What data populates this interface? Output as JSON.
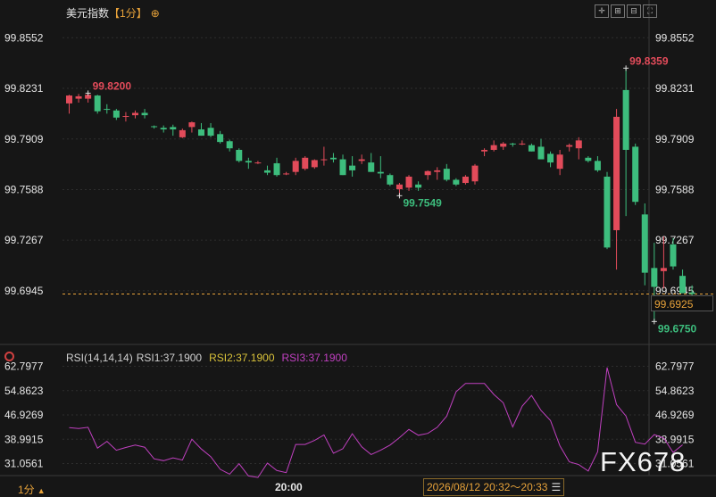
{
  "header": {
    "title": "美元指数",
    "timeframe": "【1分】",
    "marker": "⊕"
  },
  "toolbar_icons": [
    "crosshair-icon",
    "zoom-in-icon",
    "zoom-out-icon",
    "fullscreen-icon"
  ],
  "colors": {
    "up": "#e24b5a",
    "down": "#3dbd7d",
    "last_price_line": "#e8a33a",
    "rsi": "#c040c0",
    "grid": "#2e2e2e",
    "axis_text": "#e6e6e6"
  },
  "chart_data": [
    {
      "type": "candlestick",
      "title": "美元指数",
      "y_ticks": [
        "99.8552",
        "99.8231",
        "99.7909",
        "99.7588",
        "99.7267",
        "99.6945"
      ],
      "ylim": [
        99.665,
        99.865
      ],
      "annotations": {
        "high_left": "99.8200",
        "high_right": "99.8359",
        "low_mid": "99.7549",
        "low_right": "99.6750"
      },
      "last_price": "99.6925",
      "last_price_value": 99.6925,
      "candles": [
        {
          "o": 99.8135,
          "h": 99.819,
          "l": 99.807,
          "c": 99.8185
        },
        {
          "o": 99.8165,
          "h": 99.8195,
          "l": 99.814,
          "c": 99.818
        },
        {
          "o": 99.8165,
          "h": 99.82,
          "l": 99.814,
          "c": 99.819
        },
        {
          "o": 99.8185,
          "h": 99.819,
          "l": 99.807,
          "c": 99.8085
        },
        {
          "o": 99.81,
          "h": 99.813,
          "l": 99.807,
          "c": 99.8095
        },
        {
          "o": 99.809,
          "h": 99.81,
          "l": 99.803,
          "c": 99.8045
        },
        {
          "o": 99.805,
          "h": 99.808,
          "l": 99.802,
          "c": 99.8055
        },
        {
          "o": 99.806,
          "h": 99.809,
          "l": 99.804,
          "c": 99.8075
        },
        {
          "o": 99.8075,
          "h": 99.81,
          "l": 99.804,
          "c": 99.806
        },
        {
          "o": 99.799,
          "h": 99.7995,
          "l": 99.7975,
          "c": 99.7985
        },
        {
          "o": 99.798,
          "h": 99.7995,
          "l": 99.795,
          "c": 99.797
        },
        {
          "o": 99.7985,
          "h": 99.8,
          "l": 99.793,
          "c": 99.797
        },
        {
          "o": 99.792,
          "h": 99.7975,
          "l": 99.7915,
          "c": 99.7965
        },
        {
          "o": 99.7985,
          "h": 99.802,
          "l": 99.795,
          "c": 99.8015
        },
        {
          "o": 99.797,
          "h": 99.801,
          "l": 99.793,
          "c": 99.793
        },
        {
          "o": 99.798,
          "h": 99.801,
          "l": 99.792,
          "c": 99.793
        },
        {
          "o": 99.794,
          "h": 99.796,
          "l": 99.788,
          "c": 99.789
        },
        {
          "o": 99.7895,
          "h": 99.7905,
          "l": 99.783,
          "c": 99.785
        },
        {
          "o": 99.784,
          "h": 99.785,
          "l": 99.776,
          "c": 99.777
        },
        {
          "o": 99.777,
          "h": 99.779,
          "l": 99.772,
          "c": 99.776
        },
        {
          "o": 99.776,
          "h": 99.777,
          "l": 99.775,
          "c": 99.776
        },
        {
          "o": 99.771,
          "h": 99.774,
          "l": 99.768,
          "c": 99.7695
        },
        {
          "o": 99.7755,
          "h": 99.779,
          "l": 99.767,
          "c": 99.768
        },
        {
          "o": 99.7685,
          "h": 99.77,
          "l": 99.768,
          "c": 99.769
        },
        {
          "o": 99.77,
          "h": 99.779,
          "l": 99.768,
          "c": 99.777
        },
        {
          "o": 99.772,
          "h": 99.78,
          "l": 99.771,
          "c": 99.779
        },
        {
          "o": 99.773,
          "h": 99.778,
          "l": 99.772,
          "c": 99.7775
        },
        {
          "o": 99.778,
          "h": 99.786,
          "l": 99.774,
          "c": 99.778
        },
        {
          "o": 99.779,
          "h": 99.782,
          "l": 99.776,
          "c": 99.778
        },
        {
          "o": 99.778,
          "h": 99.781,
          "l": 99.768,
          "c": 99.768
        },
        {
          "o": 99.774,
          "h": 99.78,
          "l": 99.767,
          "c": 99.771
        },
        {
          "o": 99.777,
          "h": 99.781,
          "l": 99.775,
          "c": 99.778
        },
        {
          "o": 99.776,
          "h": 99.782,
          "l": 99.77,
          "c": 99.77
        },
        {
          "o": 99.77,
          "h": 99.78,
          "l": 99.766,
          "c": 99.769
        },
        {
          "o": 99.768,
          "h": 99.769,
          "l": 99.761,
          "c": 99.762
        },
        {
          "o": 99.759,
          "h": 99.763,
          "l": 99.7549,
          "c": 99.762
        },
        {
          "o": 99.76,
          "h": 99.768,
          "l": 99.758,
          "c": 99.767
        },
        {
          "o": 99.762,
          "h": 99.764,
          "l": 99.758,
          "c": 99.76
        },
        {
          "o": 99.768,
          "h": 99.771,
          "l": 99.765,
          "c": 99.7705
        },
        {
          "o": 99.77,
          "h": 99.773,
          "l": 99.765,
          "c": 99.771
        },
        {
          "o": 99.772,
          "h": 99.775,
          "l": 99.764,
          "c": 99.765
        },
        {
          "o": 99.765,
          "h": 99.766,
          "l": 99.761,
          "c": 99.762
        },
        {
          "o": 99.763,
          "h": 99.768,
          "l": 99.762,
          "c": 99.767
        },
        {
          "o": 99.764,
          "h": 99.775,
          "l": 99.762,
          "c": 99.774
        },
        {
          "o": 99.783,
          "h": 99.785,
          "l": 99.78,
          "c": 99.784
        },
        {
          "o": 99.784,
          "h": 99.79,
          "l": 99.783,
          "c": 99.787
        },
        {
          "o": 99.786,
          "h": 99.789,
          "l": 99.784,
          "c": 99.788
        },
        {
          "o": 99.788,
          "h": 99.7885,
          "l": 99.786,
          "c": 99.7875
        },
        {
          "o": 99.788,
          "h": 99.79,
          "l": 99.787,
          "c": 99.788
        },
        {
          "o": 99.787,
          "h": 99.788,
          "l": 99.783,
          "c": 99.783
        },
        {
          "o": 99.786,
          "h": 99.791,
          "l": 99.778,
          "c": 99.778
        },
        {
          "o": 99.7815,
          "h": 99.783,
          "l": 99.773,
          "c": 99.776
        },
        {
          "o": 99.772,
          "h": 99.784,
          "l": 99.768,
          "c": 99.781
        },
        {
          "o": 99.786,
          "h": 99.788,
          "l": 99.783,
          "c": 99.787
        },
        {
          "o": 99.785,
          "h": 99.792,
          "l": 99.778,
          "c": 99.79
        },
        {
          "o": 99.779,
          "h": 99.78,
          "l": 99.776,
          "c": 99.777
        },
        {
          "o": 99.777,
          "h": 99.78,
          "l": 99.77,
          "c": 99.771
        },
        {
          "o": 99.767,
          "h": 99.77,
          "l": 99.721,
          "c": 99.722
        },
        {
          "o": 99.733,
          "h": 99.81,
          "l": 99.708,
          "c": 99.805
        },
        {
          "o": 99.822,
          "h": 99.8359,
          "l": 99.742,
          "c": 99.784
        },
        {
          "o": 99.786,
          "h": 99.788,
          "l": 99.749,
          "c": 99.751
        },
        {
          "o": 99.743,
          "h": 99.75,
          "l": 99.698,
          "c": 99.706
        },
        {
          "o": 99.709,
          "h": 99.725,
          "l": 99.675,
          "c": 99.697
        },
        {
          "o": 99.707,
          "h": 99.729,
          "l": 99.696,
          "c": 99.709
        },
        {
          "o": 99.724,
          "h": 99.728,
          "l": 99.708,
          "c": 99.71
        },
        {
          "o": 99.704,
          "h": 99.708,
          "l": 99.698,
          "c": 99.693
        },
        {
          "o": 99.6935,
          "h": 99.698,
          "l": 99.69,
          "c": 99.6925
        }
      ]
    },
    {
      "type": "line",
      "title": "RSI(14,14,14)",
      "series_labels": [
        "RSI1:37.1900",
        "RSI2:37.1900",
        "RSI3:37.1900"
      ],
      "y_ticks": [
        "62.7977",
        "54.8623",
        "46.9269",
        "38.9915",
        "31.0561"
      ],
      "ylim": [
        28.0,
        65.0
      ],
      "values": [
        42.8,
        42.5,
        42.9,
        36.1,
        38.3,
        35.4,
        36.3,
        37.1,
        36.4,
        32.6,
        32.0,
        32.9,
        32.2,
        39.0,
        35.8,
        33.3,
        29.2,
        27.6,
        31.0,
        27.0,
        26.5,
        31.2,
        28.8,
        28.1,
        37.3,
        37.3,
        38.6,
        40.4,
        34.4,
        35.9,
        40.8,
        36.5,
        34.0,
        35.4,
        37.1,
        39.5,
        42.2,
        40.3,
        40.9,
        42.9,
        46.5,
        54.5,
        57.2,
        57.2,
        57.2,
        53.6,
        50.9,
        43.0,
        49.8,
        53.3,
        48.4,
        45.1,
        36.9,
        31.6,
        30.7,
        28.6,
        34.9,
        62.4,
        50.3,
        46.6,
        38.0,
        37.4,
        40.5,
        39.4,
        34.7,
        37.19
      ]
    }
  ],
  "footer": {
    "timeframe": "1分",
    "arrow": "▲",
    "time_label": "20:00",
    "range": "2026/08/12 20:32～20:33",
    "menu": "☰"
  },
  "rsi_legend": {
    "name": "RSI(14,14,14)",
    "rsi1": "RSI1:37.1900",
    "rsi2": "RSI2:37.1900",
    "rsi3": "RSI3:37.1900"
  },
  "watermark": "FX678"
}
